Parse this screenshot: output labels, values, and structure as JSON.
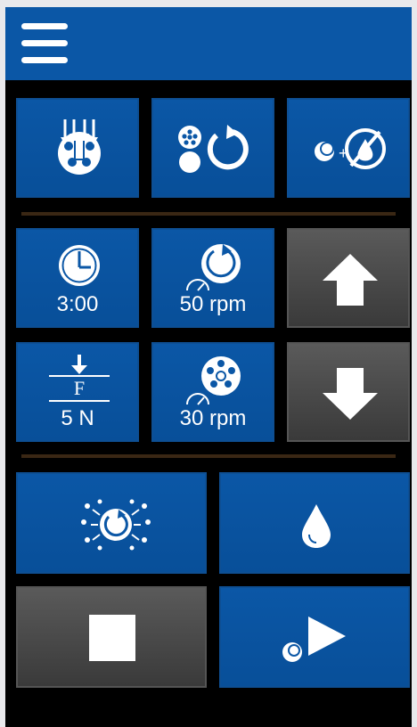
{
  "header": {
    "menu_icon": "hamburger-menu-icon",
    "color": "#0b57a6"
  },
  "top_row": [
    {
      "icon": "multi-piston-head-icon"
    },
    {
      "icon": "head-rotation-icon"
    },
    {
      "icon": "disc-and-paper-toggle-icon"
    }
  ],
  "settings": {
    "time": {
      "icon": "timer-icon",
      "value": "3:00"
    },
    "head_speed": {
      "icon": "rotation-speed-icon",
      "value": "50 rpm"
    },
    "force": {
      "icon": "force-icon",
      "label": "F",
      "value": "5 N"
    },
    "disc_speed": {
      "icon": "disc-speed-icon",
      "value": "30 rpm"
    }
  },
  "movement": {
    "up_icon": "arrow-up-icon",
    "down_icon": "arrow-down-icon"
  },
  "actions": {
    "rinse_icon": "rinse-spray-icon",
    "dose_icon": "water-drop-icon",
    "stop_icon": "stop-icon",
    "start_icon": "play-with-disc-icon"
  },
  "colors": {
    "tile_blue": "#0b57a6",
    "tile_gray": "#4a4a4a",
    "divider": "#3a2714"
  }
}
